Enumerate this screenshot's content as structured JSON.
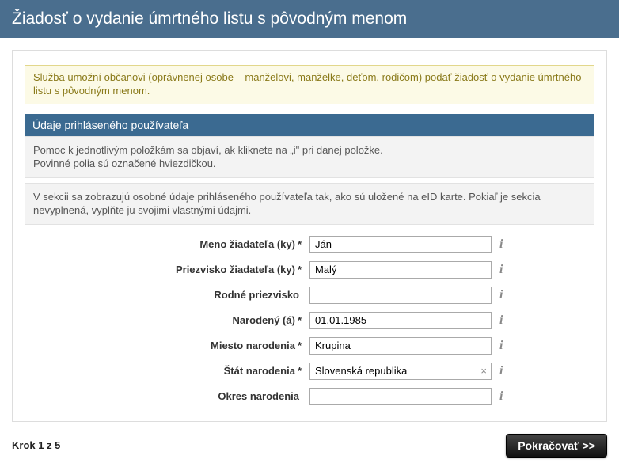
{
  "header": {
    "title": "Žiadosť o vydanie úmrtného listu s pôvodným menom"
  },
  "intro": {
    "text": "Služba umožní občanovi (oprávnenej osobe – manželovi, manželke, deťom, rodičom) podať žiadosť o vydanie úmrtného listu s pôvodným menom."
  },
  "section": {
    "title": "Údaje prihláseného používateľa",
    "help_line1": "Pomoc k jednotlivým položkám sa objaví, ak kliknete na „i\" pri danej položke.",
    "help_line2": "Povinné polia sú označené hviezdičkou.",
    "desc": "V sekcii sa zobrazujú osobné údaje prihláseného používateľa tak, ako sú uložené na eID karte. Pokiaľ je sekcia nevyplnená, vyplňte ju svojimi vlastnými údajmi."
  },
  "fields": {
    "first_name": {
      "label": "Meno žiadateľa (ky)",
      "required": "*",
      "value": "Ján"
    },
    "last_name": {
      "label": "Priezvisko žiadateľa (ky)",
      "required": "*",
      "value": "Malý"
    },
    "maiden_name": {
      "label": "Rodné priezvisko",
      "required": "",
      "value": ""
    },
    "birth_date": {
      "label": "Narodený (á)",
      "required": "*",
      "value": "01.01.1985"
    },
    "birth_place": {
      "label": "Miesto narodenia",
      "required": "*",
      "value": "Krupina"
    },
    "birth_country": {
      "label": "Štát narodenia",
      "required": "*",
      "value": "Slovenská republika"
    },
    "birth_district": {
      "label": "Okres narodenia",
      "required": "",
      "value": ""
    }
  },
  "footer": {
    "step": "Krok 1 z 5",
    "next": "Pokračovať >>"
  },
  "icons": {
    "info": "i",
    "clear": "×"
  }
}
